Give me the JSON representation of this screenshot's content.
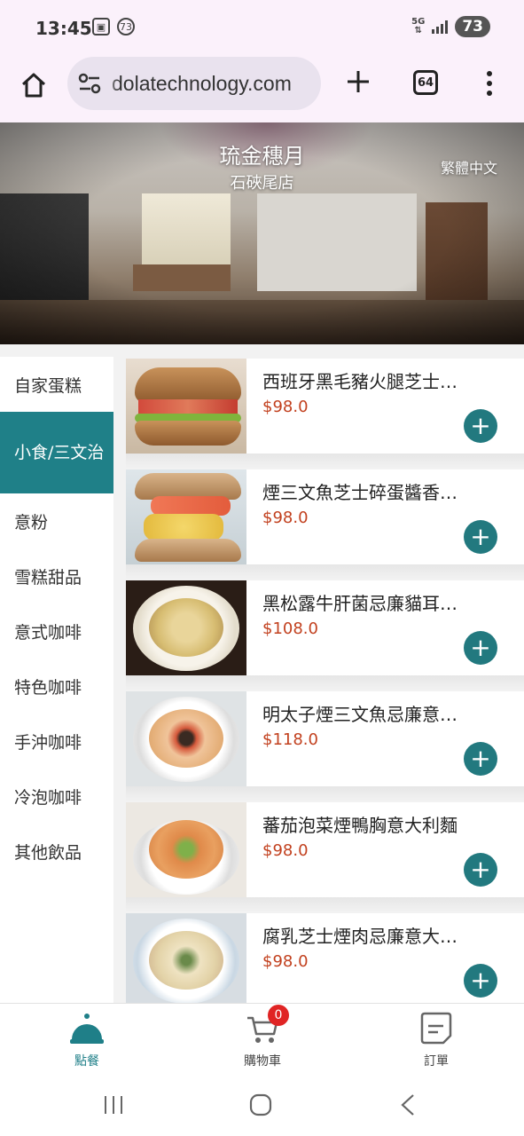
{
  "status_bar": {
    "time": "13:45",
    "notification_badge": "73",
    "network": "5G",
    "battery": "73"
  },
  "browser": {
    "url": "dolatechnology.com",
    "tab_count": "64"
  },
  "hero": {
    "title": "琉金穗月",
    "subtitle": "石硤尾店",
    "language_button": "繁體中文"
  },
  "categories": [
    {
      "label": "自家蛋糕",
      "active": false
    },
    {
      "label": "小食/三文治",
      "active": true
    },
    {
      "label": "意粉",
      "active": false
    },
    {
      "label": "雪糕甜品",
      "active": false
    },
    {
      "label": "意式咖啡",
      "active": false
    },
    {
      "label": "特色咖啡",
      "active": false
    },
    {
      "label": "手沖咖啡",
      "active": false
    },
    {
      "label": "冷泡咖啡",
      "active": false
    },
    {
      "label": "其他飲品",
      "active": false
    }
  ],
  "menu_items": [
    {
      "name": "西班牙黑毛豬火腿芝士…",
      "price": "$98.0",
      "image": "ham-sandwich"
    },
    {
      "name": "煙三文魚芝士碎蛋醬香…",
      "price": "$98.0",
      "image": "salmon-egg-sandwich"
    },
    {
      "name": "黑松露牛肝菌忌廉貓耳…",
      "price": "$108.0",
      "image": "truffle-pasta"
    },
    {
      "name": "明太子煙三文魚忌廉意…",
      "price": "$118.0",
      "image": "mentaiko-pasta"
    },
    {
      "name": "蕃茄泡菜煙鴨胸意大利麵",
      "price": "$98.0",
      "image": "tomato-duck-pasta"
    },
    {
      "name": "腐乳芝士煙肉忌廉意大…",
      "price": "$98.0",
      "image": "bacon-cream-pasta"
    }
  ],
  "bottom_nav": {
    "order": "點餐",
    "cart": "購物車",
    "cart_count": "0",
    "orders": "訂單"
  },
  "colors": {
    "accent": "#1f8088",
    "price": "#c2411f",
    "badge": "#e02424"
  }
}
